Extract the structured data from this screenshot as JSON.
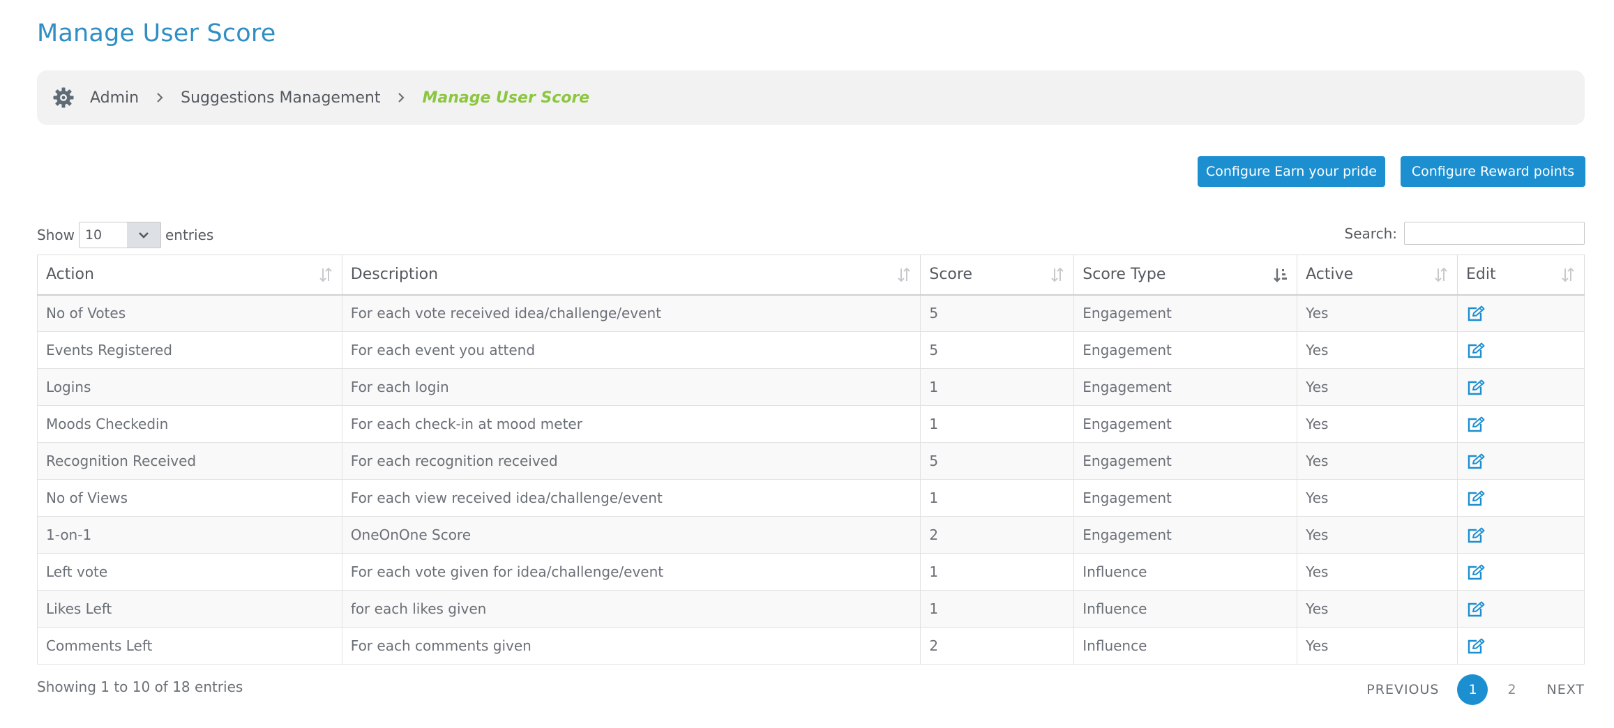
{
  "page": {
    "title": "Manage User Score"
  },
  "breadcrumb": {
    "items": [
      "Admin",
      "Suggestions Management"
    ],
    "current": "Manage User Score"
  },
  "buttons": {
    "earn_pride": "Configure Earn your pride",
    "reward_points": "Configure Reward points"
  },
  "length": {
    "show_label": "Show",
    "value": "10",
    "entries_label": "entries"
  },
  "search": {
    "label": "Search:",
    "value": ""
  },
  "table": {
    "columns": [
      "Action",
      "Description",
      "Score",
      "Score Type",
      "Active",
      "Edit"
    ],
    "rows": [
      [
        "No of Votes",
        "For each vote received idea/challenge/event",
        "5",
        "Engagement",
        "Yes"
      ],
      [
        "Events Registered",
        "For each event you attend",
        "5",
        "Engagement",
        "Yes"
      ],
      [
        "Logins",
        "For each login",
        "1",
        "Engagement",
        "Yes"
      ],
      [
        "Moods Checkedin",
        "For each check-in at mood meter",
        "1",
        "Engagement",
        "Yes"
      ],
      [
        "Recognition Received",
        "For each recognition received",
        "5",
        "Engagement",
        "Yes"
      ],
      [
        "No of Views",
        "For each view received idea/challenge/event",
        "1",
        "Engagement",
        "Yes"
      ],
      [
        "1-on-1",
        "OneOnOne Score",
        "2",
        "Engagement",
        "Yes"
      ],
      [
        "Left vote",
        "For each vote given for idea/challenge/event",
        "1",
        "Influence",
        "Yes"
      ],
      [
        "Likes Left",
        "for each likes given",
        "1",
        "Influence",
        "Yes"
      ],
      [
        "Comments Left",
        "For each comments given",
        "2",
        "Influence",
        "Yes"
      ]
    ]
  },
  "footer": {
    "info": "Showing 1 to 10 of 18 entries",
    "previous": "PREVIOUS",
    "pages": [
      "1",
      "2"
    ],
    "next": "NEXT"
  },
  "colors": {
    "accent": "#1c8fd1",
    "title": "#2f8fc4",
    "current_crumb": "#8cc63f"
  },
  "icons": {
    "breadcrumb": "gear-icon",
    "separator": "chevron-right-icon",
    "edit": "edit-icon",
    "sort": "sort-icon"
  }
}
